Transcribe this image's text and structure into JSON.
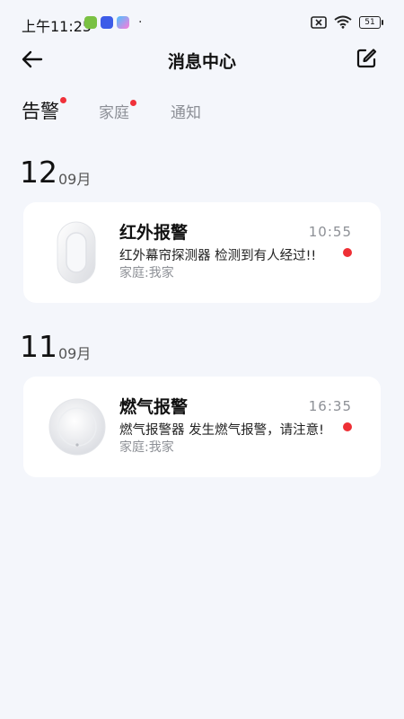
{
  "status_bar": {
    "time": "上午11:25",
    "dot": "·",
    "battery": "51"
  },
  "header": {
    "title": "消息中心"
  },
  "tabs": [
    {
      "label": "告警",
      "active": true,
      "badge": true
    },
    {
      "label": "家庭",
      "active": false,
      "badge": true
    },
    {
      "label": "通知",
      "active": false,
      "badge": false
    }
  ],
  "groups": [
    {
      "day": "12",
      "month": "09月",
      "messages": [
        {
          "title": "红外报警",
          "time": "10:55",
          "message": "红外幕帘探测器  检测到有人经过!!",
          "home": "家庭:我家",
          "unread": true,
          "thumbnail_icon": "infrared-curtain-detector-icon"
        }
      ]
    },
    {
      "day": "11",
      "month": "09月",
      "messages": [
        {
          "title": "燃气报警",
          "time": "16:35",
          "message": "燃气报警器  发生燃气报警，请注意!",
          "home": "家庭:我家",
          "unread": true,
          "thumbnail_icon": "gas-detector-icon"
        }
      ]
    }
  ],
  "colors": {
    "background": "#f4f6fb",
    "card": "#ffffff",
    "badge_red": "#f0313a",
    "muted_text": "#8d9096"
  }
}
